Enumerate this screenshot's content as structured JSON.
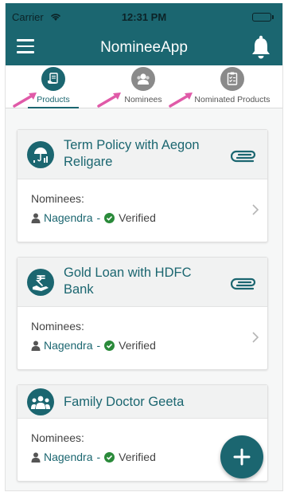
{
  "status_bar": {
    "carrier": "Carrier",
    "time": "12:31 PM"
  },
  "app_bar": {
    "title": "NomineeApp"
  },
  "tabs": [
    {
      "label": "Products",
      "icon": "products-icon",
      "active": true
    },
    {
      "label": "Nominees",
      "icon": "nominees-icon",
      "active": false
    },
    {
      "label": "Nominated Products",
      "icon": "nominated-products-icon",
      "active": false
    }
  ],
  "cards": [
    {
      "title": "Term Policy with Aegon Religare",
      "icon": "umbrella-icon",
      "nominees_label": "Nominees:",
      "nominee": "Nagendra",
      "separator": "-",
      "status": "Verified"
    },
    {
      "title": "Gold Loan with HDFC Bank",
      "icon": "rupee-hand-icon",
      "nominees_label": "Nominees:",
      "nominee": "Nagendra",
      "separator": "-",
      "status": "Verified"
    },
    {
      "title": "Family Doctor Geeta",
      "icon": "doctor-group-icon",
      "nominees_label": "Nominees:",
      "nominee": "Nagendra",
      "separator": "-",
      "status": "Verified"
    }
  ],
  "colors": {
    "primary": "#1b6670",
    "verified": "#2a8a3a",
    "annotation_arrow": "#e05aa8",
    "tab_icon_inactive": "#8a8a8a"
  }
}
